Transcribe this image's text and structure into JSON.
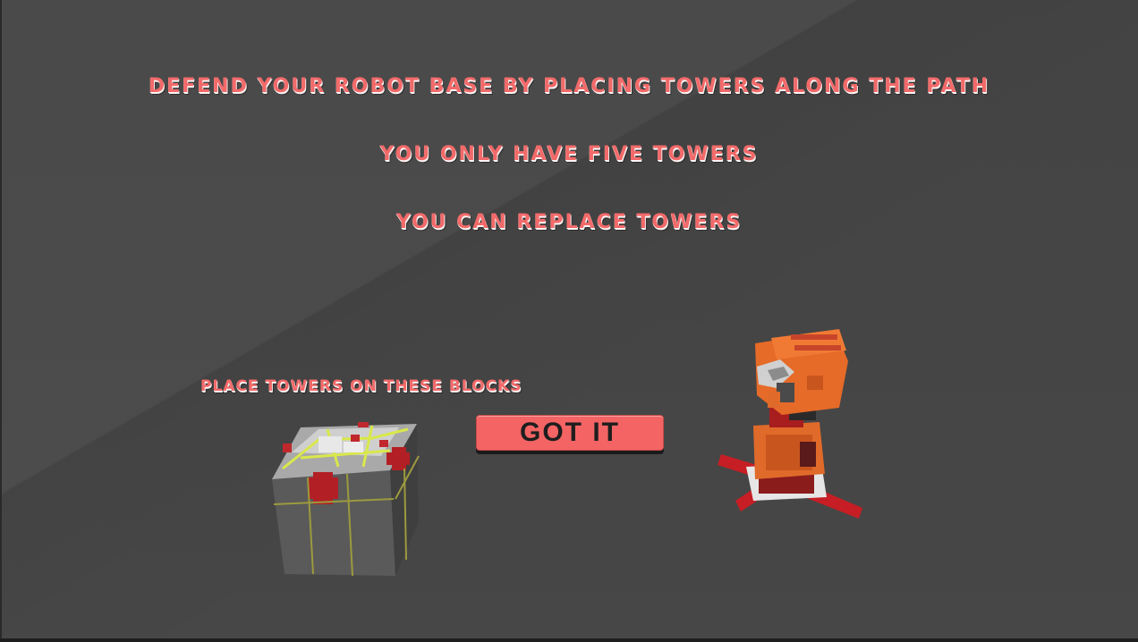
{
  "tutorial": {
    "line1": "Defend your robot base by placing towers along the path",
    "line2": "You only have five towers",
    "line3": "You can replace towers",
    "blocks_label": "Place towers on these blocks"
  },
  "button": {
    "label": "GOT IT"
  },
  "colors": {
    "text_accent": "#f26a6a",
    "button_fill": "#f46464",
    "background": "#444444"
  },
  "icons": {
    "block": "tower-block-voxel",
    "robot": "robot-tower-voxel"
  }
}
